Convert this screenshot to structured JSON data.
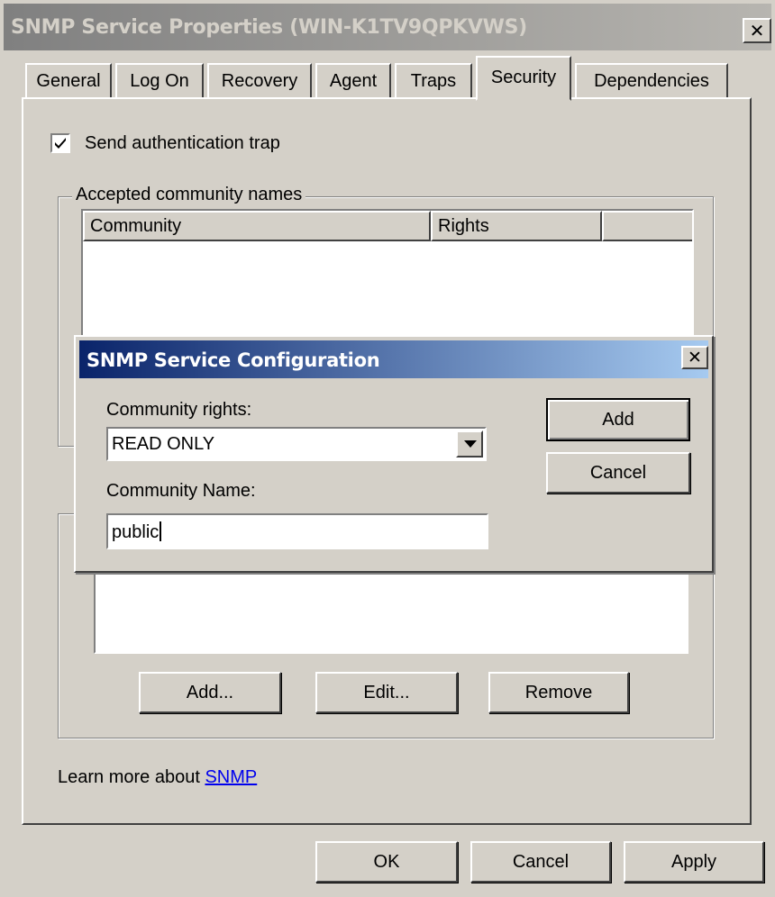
{
  "window": {
    "title": "SNMP Service Properties (WIN-K1TV9QPKVWS)",
    "close_glyph": "✕"
  },
  "tabs": [
    {
      "label": "General"
    },
    {
      "label": "Log On"
    },
    {
      "label": "Recovery"
    },
    {
      "label": "Agent"
    },
    {
      "label": "Traps"
    },
    {
      "label": "Security",
      "active": true
    },
    {
      "label": "Dependencies"
    }
  ],
  "security": {
    "send_auth_trap_label": "Send authentication trap",
    "send_auth_trap_checked": true,
    "accepted_group_label": "Accepted community names",
    "columns": [
      "Community",
      "Rights"
    ],
    "hosts_buttons": {
      "add": "Add...",
      "edit": "Edit...",
      "remove": "Remove"
    },
    "learn_more_text": "Learn more about",
    "learn_more_link": "SNMP"
  },
  "footer": {
    "ok": "OK",
    "cancel": "Cancel",
    "apply": "Apply"
  },
  "dialog": {
    "title": "SNMP Service Configuration",
    "rights_label": "Community rights:",
    "rights_value": "READ ONLY",
    "name_label": "Community Name:",
    "name_value": "public",
    "add_button": "Add",
    "cancel_button": "Cancel"
  },
  "colors": {
    "face": "#d4d0c8",
    "dialog_title_start": "#0a246a",
    "dialog_title_end": "#a6caf0",
    "link": "#0000ee"
  }
}
